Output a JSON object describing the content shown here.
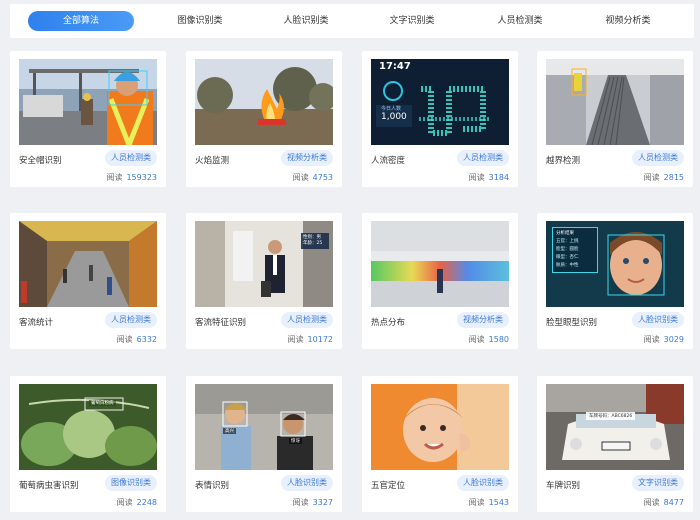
{
  "tabs": [
    {
      "label": "全部算法",
      "active": true
    },
    {
      "label": "图像识别类",
      "active": false
    },
    {
      "label": "人脸识别类",
      "active": false
    },
    {
      "label": "文字识别类",
      "active": false
    },
    {
      "label": "人员检测类",
      "active": false
    },
    {
      "label": "视频分析类",
      "active": false
    }
  ],
  "read_label": "阅读",
  "cards": [
    {
      "title": "安全帽识别",
      "category": "人员检测类",
      "reads": "159323",
      "thumb": "hardhat-photo"
    },
    {
      "title": "火焰监测",
      "category": "视频分析类",
      "reads": "4753",
      "thumb": "fire-photo"
    },
    {
      "title": "人流密度",
      "category": "人员检测类",
      "reads": "3184",
      "thumb": "crowd-density-screen",
      "overlay": {
        "time": "17:47",
        "caption": "今日人数",
        "count": "1,000"
      }
    },
    {
      "title": "越界检测",
      "category": "人员检测类",
      "reads": "2815",
      "thumb": "escalator-photo"
    },
    {
      "title": "客流统计",
      "category": "人员检测类",
      "reads": "6332",
      "thumb": "market-photo"
    },
    {
      "title": "客流特征识别",
      "category": "人员检测类",
      "reads": "10172",
      "thumb": "shopper-photo",
      "overlay": {
        "tag": "性别：男\n年龄：25"
      }
    },
    {
      "title": "热点分布",
      "category": "视频分析类",
      "reads": "1580",
      "thumb": "heatmap-photo"
    },
    {
      "title": "脸型眼型识别",
      "category": "人脸识别类",
      "reads": "3029",
      "thumb": "child-face-photo",
      "overlay": {
        "lines": [
          "分析结果",
          "五官：上挑",
          "脸型：圆脸",
          "眼型：杏仁",
          "肤质：中性"
        ]
      }
    },
    {
      "title": "葡萄病虫害识别",
      "category": "图像识别类",
      "reads": "2248",
      "thumb": "grape-leaf-photo",
      "overlay": {
        "tag": "葡萄白粉病"
      }
    },
    {
      "title": "表情识别",
      "category": "人脸识别类",
      "reads": "3327",
      "thumb": "expression-photo",
      "overlay": {
        "tags": [
          "高兴",
          "惊讶"
        ]
      }
    },
    {
      "title": "五官定位",
      "category": "人脸识别类",
      "reads": "1543",
      "thumb": "baby-photo"
    },
    {
      "title": "车牌识别",
      "category": "文字识别类",
      "reads": "8477",
      "thumb": "car-plate-photo",
      "overlay": {
        "tag": "车牌号码：ABC6826"
      }
    }
  ]
}
